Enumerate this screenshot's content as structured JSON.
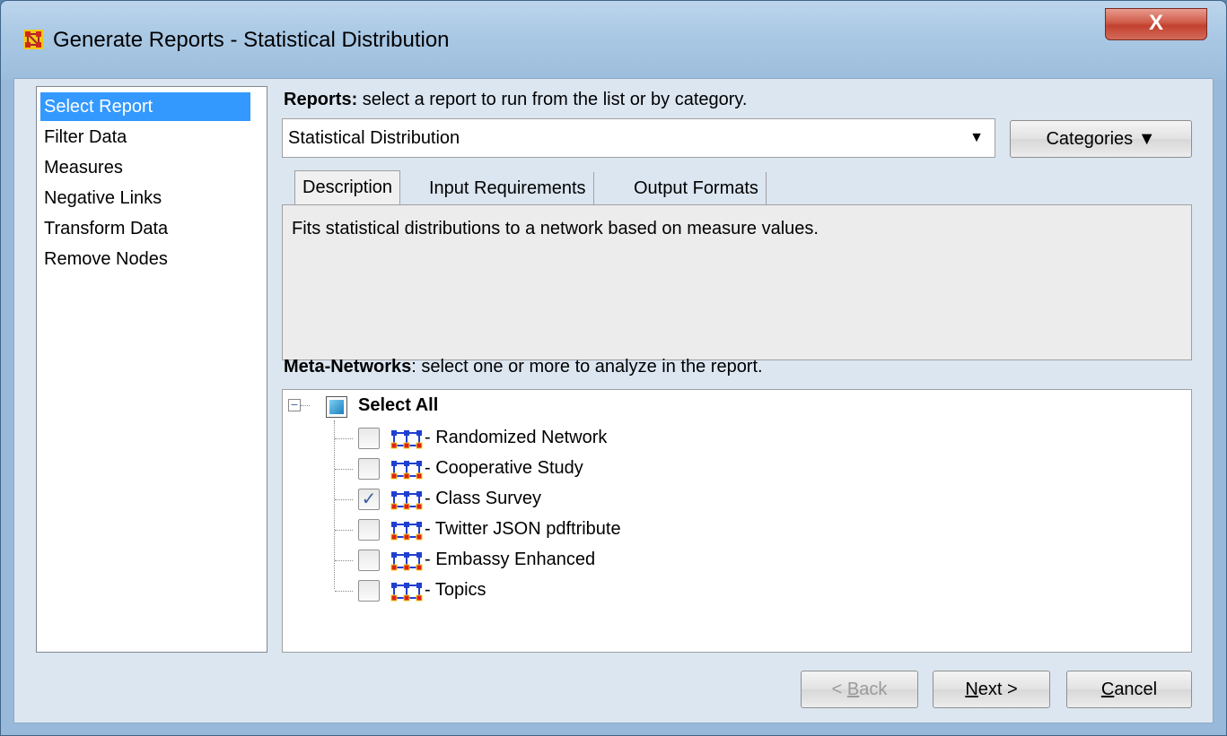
{
  "window": {
    "title": "Generate Reports - Statistical Distribution",
    "close_label": "X"
  },
  "nav": {
    "items": [
      {
        "label": "Select Report",
        "selected": true
      },
      {
        "label": "Filter Data",
        "selected": false
      },
      {
        "label": "Measures",
        "selected": false
      },
      {
        "label": "Negative Links",
        "selected": false
      },
      {
        "label": "Transform Data",
        "selected": false
      },
      {
        "label": "Remove Nodes",
        "selected": false
      }
    ]
  },
  "reports": {
    "label_bold": "Reports:",
    "label_rest": " select a report to run from the list or by category.",
    "selected": "Statistical Distribution",
    "dropdown_arrow": "▼",
    "categories_label": "Categories ▼"
  },
  "tabs": [
    {
      "label": "Description",
      "active": true
    },
    {
      "label": "Input Requirements",
      "active": false
    },
    {
      "label": "Output Formats",
      "active": false
    }
  ],
  "description": "Fits statistical distributions to a network based on measure values.",
  "meta_networks": {
    "label_bold": "Meta-Networks",
    "label_rest": ": select one or more to analyze in the report.",
    "select_all": "Select All",
    "collapse_symbol": "−",
    "items": [
      {
        "label": "- Randomized Network",
        "checked": false
      },
      {
        "label": "- Cooperative Study",
        "checked": false
      },
      {
        "label": "- Class Survey",
        "checked": true
      },
      {
        "label": "- Twitter JSON pdftribute",
        "checked": false
      },
      {
        "label": "- Embassy Enhanced",
        "checked": false
      },
      {
        "label": "- Topics",
        "checked": false
      }
    ]
  },
  "footer": {
    "back_prefix": "< ",
    "back_mnemonic": "B",
    "back_rest": "ack",
    "next_mnemonic": "N",
    "next_rest": "ext >",
    "cancel_mnemonic": "C",
    "cancel_rest": "ancel"
  },
  "colors": {
    "selection": "#3399ff",
    "icon_node_blue": "#1f3fd0",
    "icon_node_red": "#e0201a",
    "icon_node_yellow": "#f2d020",
    "check_color": "#3a5fa0"
  }
}
